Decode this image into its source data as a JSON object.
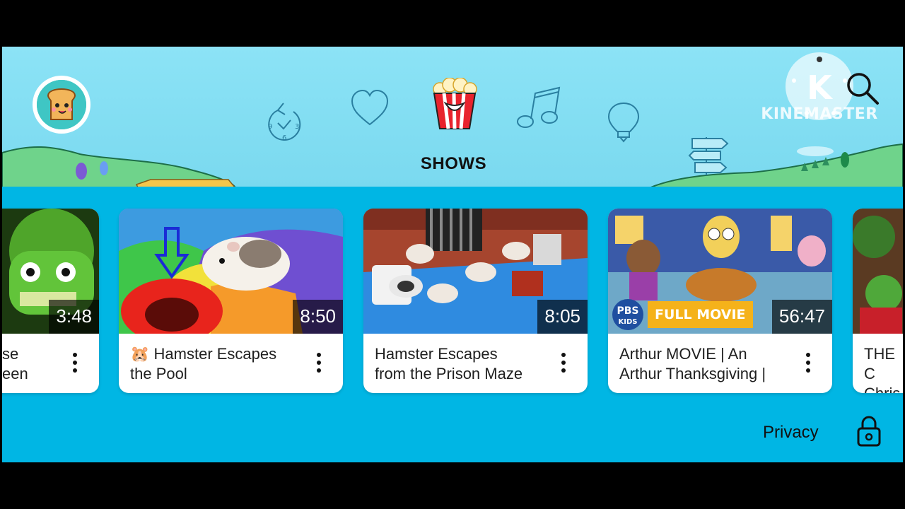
{
  "app": {
    "nav": {
      "items": [
        {
          "id": "recent",
          "icon": "clock-recent-icon"
        },
        {
          "id": "favorites",
          "icon": "heart-icon"
        },
        {
          "id": "shows",
          "icon": "popcorn-icon",
          "active": true
        },
        {
          "id": "music",
          "icon": "music-note-icon"
        },
        {
          "id": "learning",
          "icon": "lightbulb-icon"
        }
      ],
      "active_label": "SHOWS",
      "clock_digits": {
        "nine": "9",
        "three": "3",
        "six": "6"
      }
    },
    "search_icon": "search-icon",
    "profile_icon": "toast-avatar-icon",
    "watermark": {
      "letter": "K",
      "text": "KINEMASTER"
    },
    "colors": {
      "sky": "#8ce3f6",
      "ground": "#00b6e4",
      "hills": "#6fd38b",
      "nav_icon": "#2a7fa0",
      "popcorn_red": "#e8232d"
    }
  },
  "videos": [
    {
      "title": "se\neen",
      "duration": "3:48"
    },
    {
      "emoji": "🐹",
      "title": " Hamster Escapes\nthe Pool",
      "duration": "8:50"
    },
    {
      "title": "Hamster Escapes\nfrom the Prison Maze",
      "duration": "8:05"
    },
    {
      "title": "Arthur MOVIE | An\nArthur Thanksgiving |",
      "duration": "56:47",
      "badge": {
        "brand_top": "PBS",
        "brand_bottom": "KIDS",
        "label": "FULL MOVIE"
      }
    },
    {
      "title": "THE C\nChris",
      "duration": ""
    }
  ],
  "footer": {
    "privacy_label": "Privacy",
    "lock_icon": "lock-icon"
  }
}
